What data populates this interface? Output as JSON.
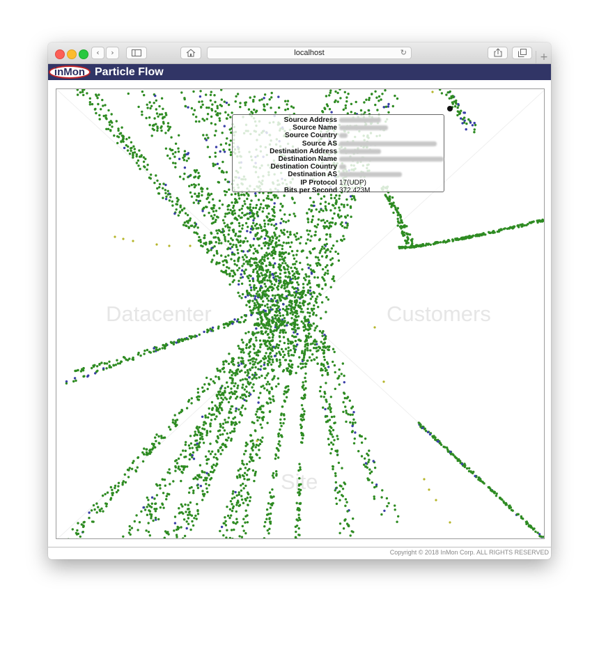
{
  "browser": {
    "address": "localhost",
    "icons": [
      "back-icon",
      "forward-icon",
      "sidebar-icon",
      "home-icon",
      "reload-icon",
      "share-icon",
      "tabs-icon",
      "new-tab-icon"
    ]
  },
  "app": {
    "logo_text": "inMon",
    "title": "Particle Flow",
    "bar_color": "#313566"
  },
  "plot": {
    "regions": {
      "left": "Datacenter",
      "right": "Customers",
      "bottom": "Site"
    },
    "colors": {
      "green": "#2e8b22",
      "blue": "#3a3fa8",
      "yellow": "#b5b52a"
    }
  },
  "tooltip": {
    "rows": [
      {
        "key": "Source Address",
        "value": ""
      },
      {
        "key": "Source Name",
        "value": ""
      },
      {
        "key": "Source Country",
        "value": ""
      },
      {
        "key": "Source AS",
        "value": ""
      },
      {
        "key": "Destination Address",
        "value": ""
      },
      {
        "key": "Destination Name",
        "value": ""
      },
      {
        "key": "Destination Country",
        "value": ""
      },
      {
        "key": "Destination AS",
        "value": ""
      },
      {
        "key": "IP Protocol",
        "value": "17(UDP)"
      },
      {
        "key": "Bits per Second",
        "value": "372.423M"
      }
    ]
  },
  "footer": {
    "copyright": "Copyright © 2018 InMon Corp. ALL RIGHTS RESERVED"
  }
}
